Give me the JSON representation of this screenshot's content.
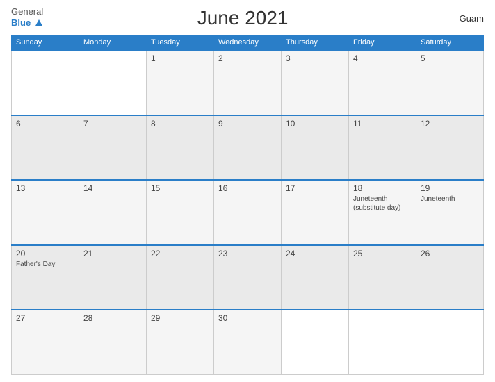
{
  "header": {
    "logo_general": "General",
    "logo_blue": "Blue",
    "title": "June 2021",
    "region": "Guam"
  },
  "weekdays": [
    "Sunday",
    "Monday",
    "Tuesday",
    "Wednesday",
    "Thursday",
    "Friday",
    "Saturday"
  ],
  "weeks": [
    [
      {
        "day": "",
        "holiday": "",
        "empty": true
      },
      {
        "day": "",
        "holiday": "",
        "empty": true
      },
      {
        "day": "1",
        "holiday": ""
      },
      {
        "day": "2",
        "holiday": ""
      },
      {
        "day": "3",
        "holiday": ""
      },
      {
        "day": "4",
        "holiday": ""
      },
      {
        "day": "5",
        "holiday": ""
      }
    ],
    [
      {
        "day": "6",
        "holiday": ""
      },
      {
        "day": "7",
        "holiday": ""
      },
      {
        "day": "8",
        "holiday": ""
      },
      {
        "day": "9",
        "holiday": ""
      },
      {
        "day": "10",
        "holiday": ""
      },
      {
        "day": "11",
        "holiday": ""
      },
      {
        "day": "12",
        "holiday": ""
      }
    ],
    [
      {
        "day": "13",
        "holiday": ""
      },
      {
        "day": "14",
        "holiday": ""
      },
      {
        "day": "15",
        "holiday": ""
      },
      {
        "day": "16",
        "holiday": ""
      },
      {
        "day": "17",
        "holiday": ""
      },
      {
        "day": "18",
        "holiday": "Juneteenth\n(substitute day)"
      },
      {
        "day": "19",
        "holiday": "Juneteenth"
      }
    ],
    [
      {
        "day": "20",
        "holiday": "Father's Day"
      },
      {
        "day": "21",
        "holiday": ""
      },
      {
        "day": "22",
        "holiday": ""
      },
      {
        "day": "23",
        "holiday": ""
      },
      {
        "day": "24",
        "holiday": ""
      },
      {
        "day": "25",
        "holiday": ""
      },
      {
        "day": "26",
        "holiday": ""
      }
    ],
    [
      {
        "day": "27",
        "holiday": ""
      },
      {
        "day": "28",
        "holiday": ""
      },
      {
        "day": "29",
        "holiday": ""
      },
      {
        "day": "30",
        "holiday": ""
      },
      {
        "day": "",
        "holiday": "",
        "empty": true
      },
      {
        "day": "",
        "holiday": "",
        "empty": true
      },
      {
        "day": "",
        "holiday": "",
        "empty": true
      }
    ]
  ]
}
